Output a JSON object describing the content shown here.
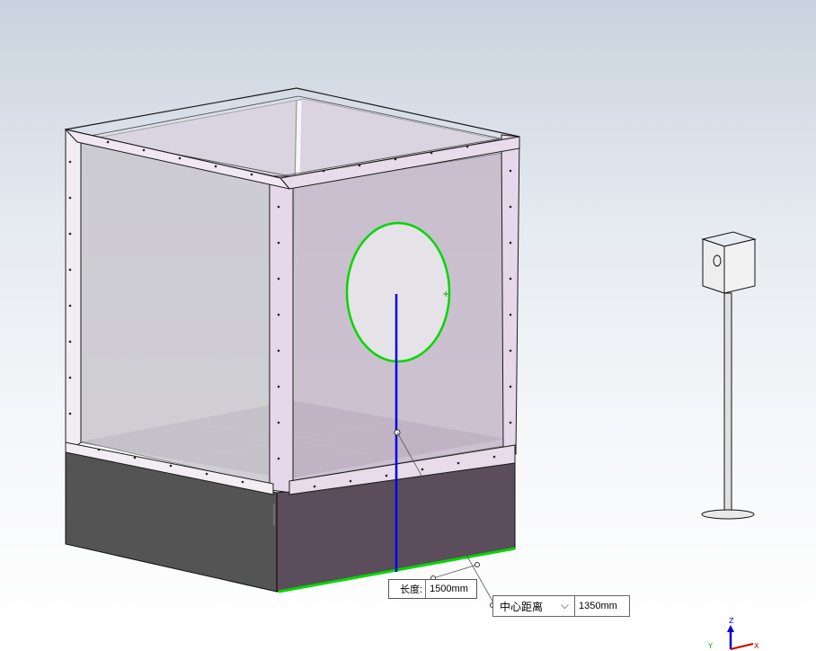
{
  "dimensions": {
    "length": {
      "caption": "长度:",
      "value": "1500mm"
    },
    "center_distance": {
      "option": "中心距离",
      "value": "1350mm"
    }
  },
  "triad": {
    "z": "Z",
    "y": "Y",
    "x": "X"
  },
  "colors": {
    "frame_edge": "#1a1a1a",
    "glass": "#c8c0d0",
    "panel_fill": "#e8dcea",
    "base_dark": "#5a4c5a",
    "base_left": "#545454",
    "selection": "#00d800",
    "dimension_line": "#0000e0"
  }
}
